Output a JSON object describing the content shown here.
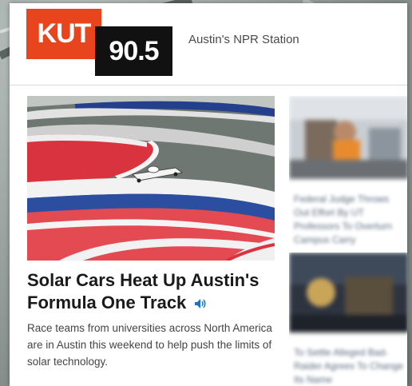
{
  "header": {
    "logo_call_letters": "KUT",
    "logo_frequency": "90.5",
    "tagline": "Austin's NPR Station"
  },
  "featured_story": {
    "headline": "Solar Cars Heat Up Austin's Formula One Track",
    "teaser": "Race teams from universities across North America are in Austin this weekend to help push the limits of solar technology.",
    "audio_icon": "speaker-icon"
  },
  "side_stories": [
    {
      "title": "Federal Judge Throws Out Effort By UT Professors To Overturn Campus Carry"
    },
    {
      "title": "To Settle Alleged Bad-Raider Agrees To Change Its Name"
    }
  ],
  "colors": {
    "logo_orange": "#e8451e",
    "logo_black": "#111111",
    "track_red": "#e03a44",
    "track_blue": "#1f3f8f"
  }
}
